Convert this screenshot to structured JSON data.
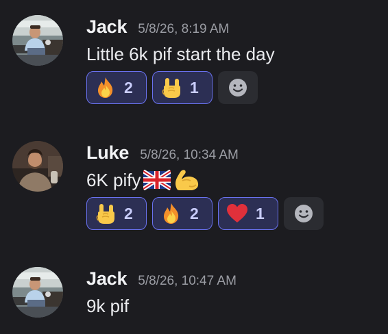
{
  "messages": [
    {
      "author": "Jack",
      "timestamp": "5/8/26, 8:19 AM",
      "text": "Little 6k pif start the day",
      "inline_emojis": [],
      "avatar_icon": "avatar-jack",
      "reactions": [
        {
          "emoji": "fire",
          "count": "2"
        },
        {
          "emoji": "sign-of-the-horns",
          "count": "1"
        }
      ]
    },
    {
      "author": "Luke",
      "timestamp": "5/8/26, 10:34 AM",
      "text": "6K pify",
      "inline_emojis": [
        "uk-flag",
        "flexed-biceps"
      ],
      "avatar_icon": "avatar-luke",
      "reactions": [
        {
          "emoji": "sign-of-the-horns",
          "count": "2"
        },
        {
          "emoji": "fire",
          "count": "2"
        },
        {
          "emoji": "red-heart",
          "count": "1"
        }
      ]
    },
    {
      "author": "Jack",
      "timestamp": "5/8/26, 10:47 AM",
      "text": "9k pif",
      "inline_emojis": [],
      "avatar_icon": "avatar-jack",
      "reactions": []
    }
  ],
  "add_reaction_icon": "smiley-add-reaction-icon",
  "colors": {
    "background": "#1c1c20",
    "reaction_bg": "#2c2f54",
    "reaction_border": "#6a72f0",
    "reaction_count": "#c9cdfb",
    "timestamp": "#9a9ca3"
  }
}
